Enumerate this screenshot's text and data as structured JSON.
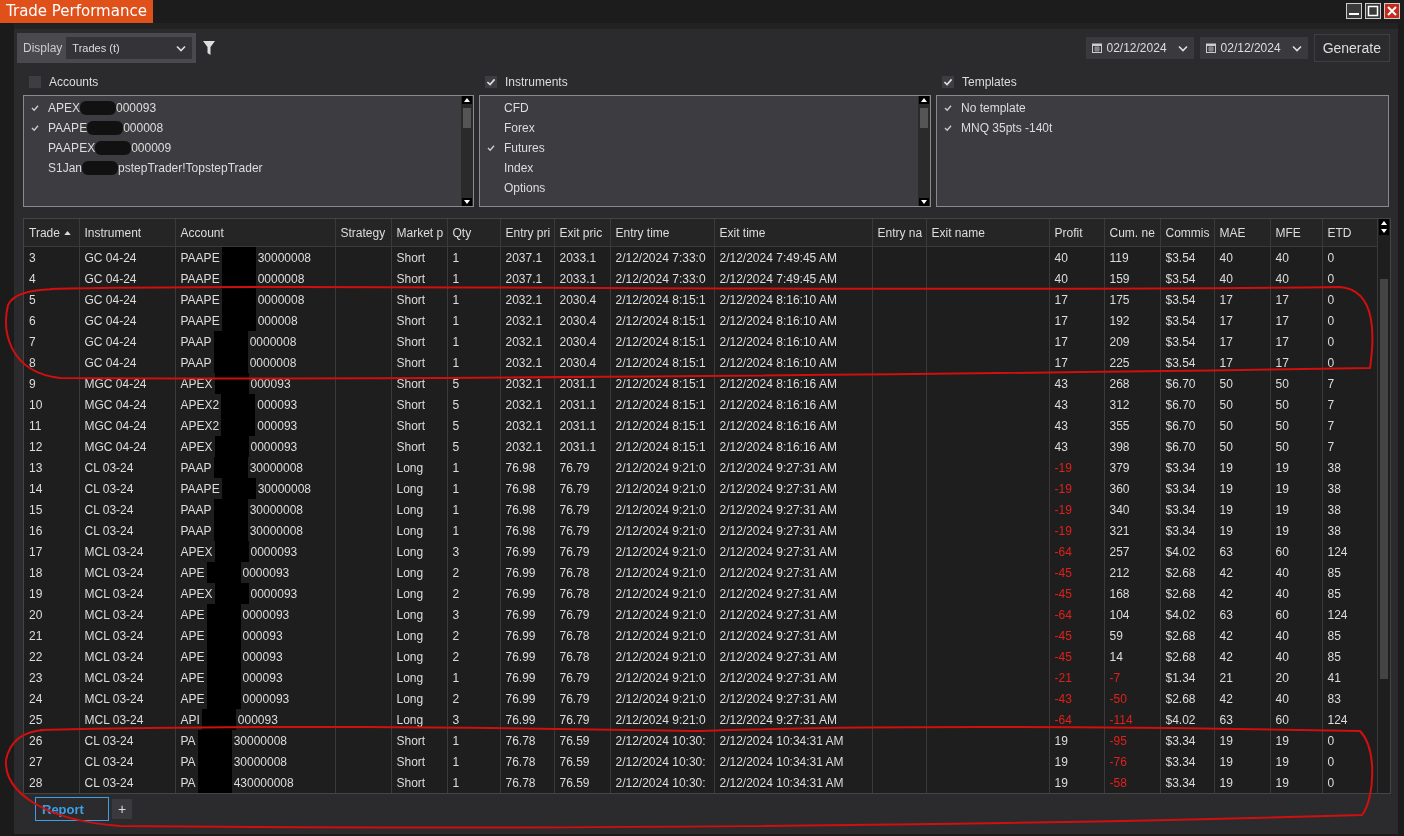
{
  "window": {
    "title": "Trade Performance"
  },
  "toolbar": {
    "display_label": "Display",
    "display_value": "Trades (t)",
    "date_from": "02/12/2024",
    "date_to": "02/12/2024",
    "generate": "Generate"
  },
  "filters": [
    {
      "label": "Accounts",
      "checked": false,
      "items": [
        {
          "prefix": "APEX",
          "suffix": "000093",
          "checked": true
        },
        {
          "prefix": "PAAPE",
          "suffix": "000008",
          "checked": true
        },
        {
          "prefix": "PAAPEX",
          "suffix": "000009",
          "checked": false
        },
        {
          "prefix": "S1Jan",
          "suffix": "pstepTrader!TopstepTrader",
          "checked": false
        }
      ]
    },
    {
      "label": "Instruments",
      "checked": true,
      "items": [
        {
          "text": "CFD",
          "checked": false
        },
        {
          "text": "Forex",
          "checked": false
        },
        {
          "text": "Futures",
          "checked": true
        },
        {
          "text": "Index",
          "checked": false
        },
        {
          "text": "Options",
          "checked": false
        }
      ]
    },
    {
      "label": "Templates",
      "checked": true,
      "items": [
        {
          "text": "No template",
          "checked": true
        },
        {
          "text": "MNQ 35pts -140t",
          "checked": true
        }
      ]
    }
  ],
  "table": {
    "columns": [
      {
        "label": "Trade",
        "sorted": true
      },
      {
        "label": "Instrument",
        "sorted": false
      },
      {
        "label": "Account",
        "sorted": false
      },
      {
        "label": "Strategy",
        "sorted": false
      },
      {
        "label": "Market p",
        "sorted": false
      },
      {
        "label": "Qty",
        "sorted": false
      },
      {
        "label": "Entry pri",
        "sorted": false
      },
      {
        "label": "Exit pric",
        "sorted": false
      },
      {
        "label": "Entry time",
        "sorted": false
      },
      {
        "label": "Exit time",
        "sorted": false
      },
      {
        "label": "Entry na",
        "sorted": false
      },
      {
        "label": "Exit name",
        "sorted": false
      },
      {
        "label": "Profit",
        "sorted": false
      },
      {
        "label": "Cum. ne",
        "sorted": false
      },
      {
        "label": "Commis",
        "sorted": false
      },
      {
        "label": "MAE",
        "sorted": false
      },
      {
        "label": "MFE",
        "sorted": false
      },
      {
        "label": "ETD",
        "sorted": false
      }
    ],
    "rows": [
      {
        "trade": "3",
        "instrument": "GC 04-24",
        "acct_prefix": "PAAPE",
        "acct_suffix": "30000008",
        "position": "Short",
        "qty": "1",
        "entry_price": "2037.1",
        "exit_price": "2033.1",
        "entry_time": "2/12/2024 7:33:0",
        "exit_time": "2/12/2024 7:49:45 AM",
        "profit": "40",
        "profit_negative": false,
        "cum": "119",
        "cum_negative": false,
        "commission": "$3.54",
        "mae": "40",
        "mfe": "40",
        "etd": "0"
      },
      {
        "trade": "4",
        "instrument": "GC 04-24",
        "acct_prefix": "PAAPE",
        "acct_suffix": "0000008",
        "position": "Short",
        "qty": "1",
        "entry_price": "2037.1",
        "exit_price": "2033.1",
        "entry_time": "2/12/2024 7:33:0",
        "exit_time": "2/12/2024 7:49:45 AM",
        "profit": "40",
        "profit_negative": false,
        "cum": "159",
        "cum_negative": false,
        "commission": "$3.54",
        "mae": "40",
        "mfe": "40",
        "etd": "0"
      },
      {
        "trade": "5",
        "instrument": "GC 04-24",
        "acct_prefix": "PAAPE",
        "acct_suffix": "0000008",
        "position": "Short",
        "qty": "1",
        "entry_price": "2032.1",
        "exit_price": "2030.4",
        "entry_time": "2/12/2024 8:15:1",
        "exit_time": "2/12/2024 8:16:10 AM",
        "profit": "17",
        "profit_negative": false,
        "cum": "175",
        "cum_negative": false,
        "commission": "$3.54",
        "mae": "17",
        "mfe": "17",
        "etd": "0"
      },
      {
        "trade": "6",
        "instrument": "GC 04-24",
        "acct_prefix": "PAAPE",
        "acct_suffix": "000008",
        "position": "Short",
        "qty": "1",
        "entry_price": "2032.1",
        "exit_price": "2030.4",
        "entry_time": "2/12/2024 8:15:1",
        "exit_time": "2/12/2024 8:16:10 AM",
        "profit": "17",
        "profit_negative": false,
        "cum": "192",
        "cum_negative": false,
        "commission": "$3.54",
        "mae": "17",
        "mfe": "17",
        "etd": "0"
      },
      {
        "trade": "7",
        "instrument": "GC 04-24",
        "acct_prefix": "PAAP",
        "acct_suffix": "0000008",
        "position": "Short",
        "qty": "1",
        "entry_price": "2032.1",
        "exit_price": "2030.4",
        "entry_time": "2/12/2024 8:15:1",
        "exit_time": "2/12/2024 8:16:10 AM",
        "profit": "17",
        "profit_negative": false,
        "cum": "209",
        "cum_negative": false,
        "commission": "$3.54",
        "mae": "17",
        "mfe": "17",
        "etd": "0"
      },
      {
        "trade": "8",
        "instrument": "GC 04-24",
        "acct_prefix": "PAAP",
        "acct_suffix": "0000008",
        "position": "Short",
        "qty": "1",
        "entry_price": "2032.1",
        "exit_price": "2030.4",
        "entry_time": "2/12/2024 8:15:1",
        "exit_time": "2/12/2024 8:16:10 AM",
        "profit": "17",
        "profit_negative": false,
        "cum": "225",
        "cum_negative": false,
        "commission": "$3.54",
        "mae": "17",
        "mfe": "17",
        "etd": "0"
      },
      {
        "trade": "9",
        "instrument": "MGC 04-24",
        "acct_prefix": "APEX",
        "acct_suffix": "000093",
        "position": "Short",
        "qty": "5",
        "entry_price": "2032.1",
        "exit_price": "2031.1",
        "entry_time": "2/12/2024 8:15:1",
        "exit_time": "2/12/2024 8:16:16 AM",
        "profit": "43",
        "profit_negative": false,
        "cum": "268",
        "cum_negative": false,
        "commission": "$6.70",
        "mae": "50",
        "mfe": "50",
        "etd": "7"
      },
      {
        "trade": "10",
        "instrument": "MGC 04-24",
        "acct_prefix": "APEX2",
        "acct_suffix": "000093",
        "position": "Short",
        "qty": "5",
        "entry_price": "2032.1",
        "exit_price": "2031.1",
        "entry_time": "2/12/2024 8:15:1",
        "exit_time": "2/12/2024 8:16:16 AM",
        "profit": "43",
        "profit_negative": false,
        "cum": "312",
        "cum_negative": false,
        "commission": "$6.70",
        "mae": "50",
        "mfe": "50",
        "etd": "7"
      },
      {
        "trade": "11",
        "instrument": "MGC 04-24",
        "acct_prefix": "APEX2",
        "acct_suffix": "000093",
        "position": "Short",
        "qty": "5",
        "entry_price": "2032.1",
        "exit_price": "2031.1",
        "entry_time": "2/12/2024 8:15:1",
        "exit_time": "2/12/2024 8:16:16 AM",
        "profit": "43",
        "profit_negative": false,
        "cum": "355",
        "cum_negative": false,
        "commission": "$6.70",
        "mae": "50",
        "mfe": "50",
        "etd": "7"
      },
      {
        "trade": "12",
        "instrument": "MGC 04-24",
        "acct_prefix": "APEX",
        "acct_suffix": "0000093",
        "position": "Short",
        "qty": "5",
        "entry_price": "2032.1",
        "exit_price": "2031.1",
        "entry_time": "2/12/2024 8:15:1",
        "exit_time": "2/12/2024 8:16:16 AM",
        "profit": "43",
        "profit_negative": false,
        "cum": "398",
        "cum_negative": false,
        "commission": "$6.70",
        "mae": "50",
        "mfe": "50",
        "etd": "7"
      },
      {
        "trade": "13",
        "instrument": "CL 03-24",
        "acct_prefix": "PAAP",
        "acct_suffix": "30000008",
        "position": "Long",
        "qty": "1",
        "entry_price": "76.98",
        "exit_price": "76.79",
        "entry_time": "2/12/2024 9:21:0",
        "exit_time": "2/12/2024 9:27:31 AM",
        "profit": "-19",
        "profit_negative": true,
        "cum": "379",
        "cum_negative": false,
        "commission": "$3.34",
        "mae": "19",
        "mfe": "19",
        "etd": "38"
      },
      {
        "trade": "14",
        "instrument": "CL 03-24",
        "acct_prefix": "PAAPE",
        "acct_suffix": "30000008",
        "position": "Long",
        "qty": "1",
        "entry_price": "76.98",
        "exit_price": "76.79",
        "entry_time": "2/12/2024 9:21:0",
        "exit_time": "2/12/2024 9:27:31 AM",
        "profit": "-19",
        "profit_negative": true,
        "cum": "360",
        "cum_negative": false,
        "commission": "$3.34",
        "mae": "19",
        "mfe": "19",
        "etd": "38"
      },
      {
        "trade": "15",
        "instrument": "CL 03-24",
        "acct_prefix": "PAAP",
        "acct_suffix": "30000008",
        "position": "Long",
        "qty": "1",
        "entry_price": "76.98",
        "exit_price": "76.79",
        "entry_time": "2/12/2024 9:21:0",
        "exit_time": "2/12/2024 9:27:31 AM",
        "profit": "-19",
        "profit_negative": true,
        "cum": "340",
        "cum_negative": false,
        "commission": "$3.34",
        "mae": "19",
        "mfe": "19",
        "etd": "38"
      },
      {
        "trade": "16",
        "instrument": "CL 03-24",
        "acct_prefix": "PAAP",
        "acct_suffix": "30000008",
        "position": "Long",
        "qty": "1",
        "entry_price": "76.98",
        "exit_price": "76.79",
        "entry_time": "2/12/2024 9:21:0",
        "exit_time": "2/12/2024 9:27:31 AM",
        "profit": "-19",
        "profit_negative": true,
        "cum": "321",
        "cum_negative": false,
        "commission": "$3.34",
        "mae": "19",
        "mfe": "19",
        "etd": "38"
      },
      {
        "trade": "17",
        "instrument": "MCL 03-24",
        "acct_prefix": "APEX",
        "acct_suffix": "0000093",
        "position": "Long",
        "qty": "3",
        "entry_price": "76.99",
        "exit_price": "76.79",
        "entry_time": "2/12/2024 9:21:0",
        "exit_time": "2/12/2024 9:27:31 AM",
        "profit": "-64",
        "profit_negative": true,
        "cum": "257",
        "cum_negative": false,
        "commission": "$4.02",
        "mae": "63",
        "mfe": "60",
        "etd": "124"
      },
      {
        "trade": "18",
        "instrument": "MCL 03-24",
        "acct_prefix": "APE",
        "acct_suffix": "0000093",
        "position": "Long",
        "qty": "2",
        "entry_price": "76.99",
        "exit_price": "76.78",
        "entry_time": "2/12/2024 9:21:0",
        "exit_time": "2/12/2024 9:27:31 AM",
        "profit": "-45",
        "profit_negative": true,
        "cum": "212",
        "cum_negative": false,
        "commission": "$2.68",
        "mae": "42",
        "mfe": "40",
        "etd": "85"
      },
      {
        "trade": "19",
        "instrument": "MCL 03-24",
        "acct_prefix": "APEX",
        "acct_suffix": "0000093",
        "position": "Long",
        "qty": "2",
        "entry_price": "76.99",
        "exit_price": "76.78",
        "entry_time": "2/12/2024 9:21:0",
        "exit_time": "2/12/2024 9:27:31 AM",
        "profit": "-45",
        "profit_negative": true,
        "cum": "168",
        "cum_negative": false,
        "commission": "$2.68",
        "mae": "42",
        "mfe": "40",
        "etd": "85"
      },
      {
        "trade": "20",
        "instrument": "MCL 03-24",
        "acct_prefix": "APE",
        "acct_suffix": "0000093",
        "position": "Long",
        "qty": "3",
        "entry_price": "76.99",
        "exit_price": "76.79",
        "entry_time": "2/12/2024 9:21:0",
        "exit_time": "2/12/2024 9:27:31 AM",
        "profit": "-64",
        "profit_negative": true,
        "cum": "104",
        "cum_negative": false,
        "commission": "$4.02",
        "mae": "63",
        "mfe": "60",
        "etd": "124"
      },
      {
        "trade": "21",
        "instrument": "MCL 03-24",
        "acct_prefix": "APE",
        "acct_suffix": "000093",
        "position": "Long",
        "qty": "2",
        "entry_price": "76.99",
        "exit_price": "76.78",
        "entry_time": "2/12/2024 9:21:0",
        "exit_time": "2/12/2024 9:27:31 AM",
        "profit": "-45",
        "profit_negative": true,
        "cum": "59",
        "cum_negative": false,
        "commission": "$2.68",
        "mae": "42",
        "mfe": "40",
        "etd": "85"
      },
      {
        "trade": "22",
        "instrument": "MCL 03-24",
        "acct_prefix": "APE",
        "acct_suffix": "000093",
        "position": "Long",
        "qty": "2",
        "entry_price": "76.99",
        "exit_price": "76.78",
        "entry_time": "2/12/2024 9:21:0",
        "exit_time": "2/12/2024 9:27:31 AM",
        "profit": "-45",
        "profit_negative": true,
        "cum": "14",
        "cum_negative": false,
        "commission": "$2.68",
        "mae": "42",
        "mfe": "40",
        "etd": "85"
      },
      {
        "trade": "23",
        "instrument": "MCL 03-24",
        "acct_prefix": "APE",
        "acct_suffix": "000093",
        "position": "Long",
        "qty": "1",
        "entry_price": "76.99",
        "exit_price": "76.79",
        "entry_time": "2/12/2024 9:21:0",
        "exit_time": "2/12/2024 9:27:31 AM",
        "profit": "-21",
        "profit_negative": true,
        "cum": "-7",
        "cum_negative": true,
        "commission": "$1.34",
        "mae": "21",
        "mfe": "20",
        "etd": "41"
      },
      {
        "trade": "24",
        "instrument": "MCL 03-24",
        "acct_prefix": "APE",
        "acct_suffix": "0000093",
        "position": "Long",
        "qty": "2",
        "entry_price": "76.99",
        "exit_price": "76.79",
        "entry_time": "2/12/2024 9:21:0",
        "exit_time": "2/12/2024 9:27:31 AM",
        "profit": "-43",
        "profit_negative": true,
        "cum": "-50",
        "cum_negative": true,
        "commission": "$2.68",
        "mae": "42",
        "mfe": "40",
        "etd": "83"
      },
      {
        "trade": "25",
        "instrument": "MCL 03-24",
        "acct_prefix": "API",
        "acct_suffix": "000093",
        "position": "Long",
        "qty": "3",
        "entry_price": "76.99",
        "exit_price": "76.79",
        "entry_time": "2/12/2024 9:21:0",
        "exit_time": "2/12/2024 9:27:31 AM",
        "profit": "-64",
        "profit_negative": true,
        "cum": "-114",
        "cum_negative": true,
        "commission": "$4.02",
        "mae": "63",
        "mfe": "60",
        "etd": "124"
      },
      {
        "trade": "26",
        "instrument": "CL 03-24",
        "acct_prefix": "PA",
        "acct_suffix": "30000008",
        "position": "Short",
        "qty": "1",
        "entry_price": "76.78",
        "exit_price": "76.59",
        "entry_time": "2/12/2024 10:30:",
        "exit_time": "2/12/2024 10:34:31 AM",
        "profit": "19",
        "profit_negative": false,
        "cum": "-95",
        "cum_negative": true,
        "commission": "$3.34",
        "mae": "19",
        "mfe": "19",
        "etd": "0"
      },
      {
        "trade": "27",
        "instrument": "CL 03-24",
        "acct_prefix": "PA",
        "acct_suffix": "30000008",
        "position": "Short",
        "qty": "1",
        "entry_price": "76.78",
        "exit_price": "76.59",
        "entry_time": "2/12/2024 10:30:",
        "exit_time": "2/12/2024 10:34:31 AM",
        "profit": "19",
        "profit_negative": false,
        "cum": "-76",
        "cum_negative": true,
        "commission": "$3.34",
        "mae": "19",
        "mfe": "19",
        "etd": "0"
      },
      {
        "trade": "28",
        "instrument": "CL 03-24",
        "acct_prefix": "PA",
        "acct_suffix": "430000008",
        "position": "Short",
        "qty": "1",
        "entry_price": "76.78",
        "exit_price": "76.59",
        "entry_time": "2/12/2024 10:30:",
        "exit_time": "2/12/2024 10:34:31 AM",
        "profit": "19",
        "profit_negative": false,
        "cum": "-58",
        "cum_negative": true,
        "commission": "$3.34",
        "mae": "19",
        "mfe": "19",
        "etd": "0"
      }
    ]
  },
  "bottom_tabs": [
    {
      "label": "Report",
      "selected": true
    }
  ],
  "add_tab": "+"
}
